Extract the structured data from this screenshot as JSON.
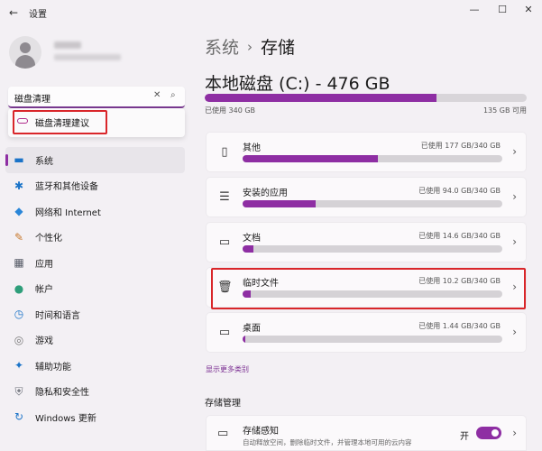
{
  "window": {
    "title": "设置",
    "back_icon": "←",
    "minimize": "—",
    "maximize": "☐",
    "close": "✕"
  },
  "search": {
    "value": "磁盘清理",
    "clear_icon": "✕",
    "search_icon": "⌕"
  },
  "suggestion": {
    "label": "磁盘清理建议"
  },
  "nav": [
    {
      "label": "系统",
      "icon": "▬",
      "color": "#1a73c8",
      "active": true
    },
    {
      "label": "蓝牙和其他设备",
      "icon": "✱",
      "color": "#1a73c8"
    },
    {
      "label": "网络和 Internet",
      "icon": "◆",
      "color": "#2a86d8"
    },
    {
      "label": "个性化",
      "icon": "✎",
      "color": "#c7772a"
    },
    {
      "label": "应用",
      "icon": "▦",
      "color": "#555a66"
    },
    {
      "label": "帐户",
      "icon": "●",
      "color": "#2e9e7a"
    },
    {
      "label": "时间和语言",
      "icon": "◷",
      "color": "#1a73c8"
    },
    {
      "label": "游戏",
      "icon": "◎",
      "color": "#7a7a7a"
    },
    {
      "label": "辅助功能",
      "icon": "✦",
      "color": "#1a73c8"
    },
    {
      "label": "隐私和安全性",
      "icon": "⛨",
      "color": "#6b6f78"
    },
    {
      "label": "Windows 更新",
      "icon": "↻",
      "color": "#1a73c8"
    }
  ],
  "breadcrumb": {
    "parent": "系统",
    "separator": "›",
    "current": "存储"
  },
  "drive": {
    "title": "本地磁盘 (C:) - 476 GB",
    "used_label": "已使用 340 GB",
    "free_label": "135 GB 可用",
    "used_fraction": 0.72
  },
  "categories": [
    {
      "name": "其他",
      "size": "已使用 177 GB/340 GB",
      "fraction": 0.52,
      "icon": "▯"
    },
    {
      "name": "安装的应用",
      "size": "已使用 94.0 GB/340 GB",
      "fraction": 0.28,
      "icon": "☰"
    },
    {
      "name": "文档",
      "size": "已使用 14.6 GB/340 GB",
      "fraction": 0.043,
      "icon": "▭"
    },
    {
      "name": "临时文件",
      "size": "已使用 10.2 GB/340 GB",
      "fraction": 0.03,
      "icon": "🗑"
    },
    {
      "name": "桌面",
      "size": "已使用 1.44 GB/340 GB",
      "fraction": 0.004,
      "icon": "▭"
    }
  ],
  "show_more": "显示更多类别",
  "management": {
    "title": "存储管理",
    "sense_name": "存储感知",
    "sense_desc": "自动释放空间，删除临时文件，并管理本地可用的云内容",
    "toggle_label": "开",
    "toggle_on": true
  },
  "chevron": "›"
}
